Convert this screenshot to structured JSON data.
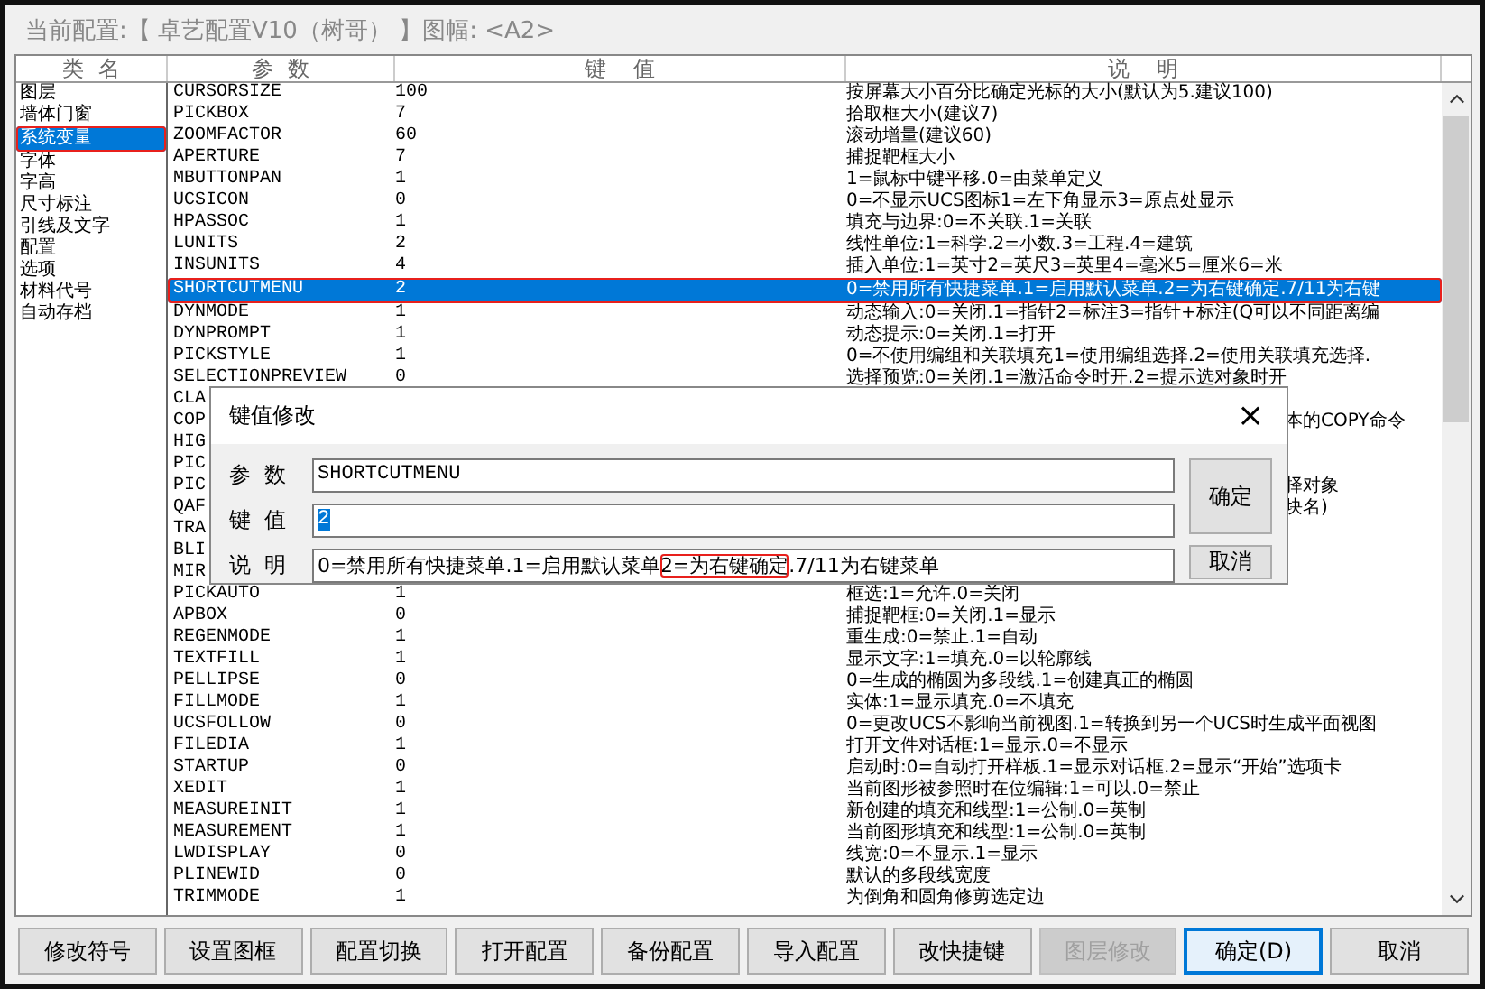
{
  "header": {
    "label": "当前配置:【 卓艺配置V10（树哥） 】图幅: <A2>"
  },
  "columns": [
    "类  名",
    "参  数",
    "键    值",
    "说    明"
  ],
  "categories": [
    {
      "label": "图层",
      "selected": false,
      "marked": false
    },
    {
      "label": "墙体门窗",
      "selected": false,
      "marked": false
    },
    {
      "label": "系统变量",
      "selected": true,
      "marked": true
    },
    {
      "label": "字体",
      "selected": false,
      "marked": false
    },
    {
      "label": "字高",
      "selected": false,
      "marked": false
    },
    {
      "label": "尺寸标注",
      "selected": false,
      "marked": false
    },
    {
      "label": "引线及文字",
      "selected": false,
      "marked": false
    },
    {
      "label": "配置",
      "selected": false,
      "marked": false
    },
    {
      "label": "选项",
      "selected": false,
      "marked": false
    },
    {
      "label": "材料代号",
      "selected": false,
      "marked": false
    },
    {
      "label": "自动存档",
      "selected": false,
      "marked": false
    }
  ],
  "rows": [
    {
      "param": "CURSORSIZE",
      "value": "100",
      "description": "按屏幕大小百分比确定光标的大小(默认为5.建议100)",
      "selected": false,
      "marked": false
    },
    {
      "param": "PICKBOX",
      "value": "7",
      "description": "拾取框大小(建议7)",
      "selected": false,
      "marked": false
    },
    {
      "param": "ZOOMFACTOR",
      "value": "60",
      "description": "滚动增量(建议60)",
      "selected": false,
      "marked": false
    },
    {
      "param": "APERTURE",
      "value": "7",
      "description": "捕捉靶框大小",
      "selected": false,
      "marked": false
    },
    {
      "param": "MBUTTONPAN",
      "value": "1",
      "description": "1=鼠标中键平移.0=由菜单定义",
      "selected": false,
      "marked": false
    },
    {
      "param": "UCSICON",
      "value": "0",
      "description": "0=不显示UCS图标1=左下角显示3=原点处显示",
      "selected": false,
      "marked": false
    },
    {
      "param": "HPASSOC",
      "value": "1",
      "description": "填充与边界:0=不关联.1=关联",
      "selected": false,
      "marked": false
    },
    {
      "param": "LUNITS",
      "value": "2",
      "description": "线性单位:1=科学.2=小数.3=工程.4=建筑",
      "selected": false,
      "marked": false
    },
    {
      "param": "INSUNITS",
      "value": "4",
      "description": "插入单位:1=英寸2=英尺3=英里4=毫米5=厘米6=米",
      "selected": false,
      "marked": false
    },
    {
      "param": "SHORTCUTMENU",
      "value": "2",
      "description": "0=禁用所有快捷菜单.1=启用默认菜单.2=为右键确定.7/11为右键",
      "selected": true,
      "marked": true
    },
    {
      "param": "DYNMODE",
      "value": "1",
      "description": "动态输入:0=关闭.1=指针2=标注3=指针+标注(Q可以不同距离编",
      "selected": false,
      "marked": false
    },
    {
      "param": "DYNPROMPT",
      "value": "1",
      "description": "动态提示:0=关闭.1=打开",
      "selected": false,
      "marked": false
    },
    {
      "param": "PICKSTYLE",
      "value": "1",
      "description": "0=不使用编组和关联填充1=使用编组选择.2=使用关联填充选择.",
      "selected": false,
      "marked": false
    },
    {
      "param": "SELECTIONPREVIEW",
      "value": "0",
      "description": "选择预览:0=关闭.1=激活命令时开.2=提示选对象时开",
      "selected": false,
      "marked": false
    },
    {
      "param": "CLA",
      "selected": false,
      "marked": false
    },
    {
      "param": "COP",
      "description": "本的COPY命令",
      "selected": false,
      "marked": false
    },
    {
      "param": "HIG",
      "selected": false,
      "marked": false
    },
    {
      "param": "PIC",
      "selected": false,
      "marked": false
    },
    {
      "param": "PIC",
      "description": "择对象",
      "selected": false,
      "marked": false
    },
    {
      "param": "QAF",
      "description": "块名)",
      "selected": false,
      "marked": false
    },
    {
      "param": "TRA",
      "selected": false,
      "marked": false
    },
    {
      "param": "BLI",
      "selected": false,
      "marked": false
    },
    {
      "param": "MIR",
      "selected": false,
      "marked": false
    },
    {
      "param": "PICKAUTO",
      "value": "1",
      "description": "框选:1=允许.0=关闭",
      "selected": false,
      "marked": false
    },
    {
      "param": "APBOX",
      "value": "0",
      "description": "捕捉靶框:0=关闭.1=显示",
      "selected": false,
      "marked": false
    },
    {
      "param": "REGENMODE",
      "value": "1",
      "description": "重生成:0=禁止.1=自动",
      "selected": false,
      "marked": false
    },
    {
      "param": "TEXTFILL",
      "value": "1",
      "description": "显示文字:1=填充.0=以轮廓线",
      "selected": false,
      "marked": false
    },
    {
      "param": "PELLIPSE",
      "value": "0",
      "description": "0=生成的椭圆为多段线.1=创建真正的椭圆",
      "selected": false,
      "marked": false
    },
    {
      "param": "FILLMODE",
      "value": "1",
      "description": "实体:1=显示填充.0=不填充",
      "selected": false,
      "marked": false
    },
    {
      "param": "UCSFOLLOW",
      "value": "0",
      "description": "0=更改UCS不影响当前视图.1=转换到另一个UCS时生成平面视图",
      "selected": false,
      "marked": false
    },
    {
      "param": "FILEDIA",
      "value": "1",
      "description": "打开文件对话框:1=显示.0=不显示",
      "selected": false,
      "marked": false
    },
    {
      "param": "STARTUP",
      "value": "0",
      "description": "启动时:0=自动打开样板.1=显示对话框.2=显示“开始”选项卡",
      "selected": false,
      "marked": false
    },
    {
      "param": "XEDIT",
      "value": "1",
      "description": "当前图形被参照时在位编辑:1=可以.0=禁止",
      "selected": false,
      "marked": false
    },
    {
      "param": "MEASUREINIT",
      "value": "1",
      "description": "新创建的填充和线型:1=公制.0=英制",
      "selected": false,
      "marked": false
    },
    {
      "param": "MEASUREMENT",
      "value": "1",
      "description": "当前图形填充和线型:1=公制.0=英制",
      "selected": false,
      "marked": false
    },
    {
      "param": "LWDISPLAY",
      "value": "0",
      "description": "线宽:0=不显示.1=显示",
      "selected": false,
      "marked": false
    },
    {
      "param": "PLINEWID",
      "value": "0",
      "description": "默认的多段线宽度",
      "selected": false,
      "marked": false
    },
    {
      "param": "TRIMMODE",
      "value": "1",
      "description": "为倒角和圆角修剪选定边",
      "selected": false,
      "marked": false
    }
  ],
  "dialog": {
    "title": "键值修改",
    "close": "×",
    "param_field": {
      "label": "参  数",
      "value": "SHORTCUTMENU"
    },
    "value_field": {
      "label": "键  值",
      "value": "2",
      "text_selected": true
    },
    "description_field": {
      "label": "说  明",
      "segments": [
        {
          "text": "0=禁用所有快捷菜单.1=启用默认菜单",
          "marked": false
        },
        {
          "text": "2=为右键确定",
          "marked": true
        },
        {
          "text": ".7/11为右键菜单",
          "marked": false
        }
      ]
    },
    "ok": "确定",
    "cancel": "取消"
  },
  "buttons": [
    {
      "label": "修改符号",
      "disabled": false,
      "default": false
    },
    {
      "label": "设置图框",
      "disabled": false,
      "default": false
    },
    {
      "label": "配置切换",
      "disabled": false,
      "default": false
    },
    {
      "label": "打开配置",
      "disabled": false,
      "default": false
    },
    {
      "label": "备份配置",
      "disabled": false,
      "default": false
    },
    {
      "label": "导入配置",
      "disabled": false,
      "default": false
    },
    {
      "label": "改快捷键",
      "disabled": false,
      "default": false
    },
    {
      "label": "图层修改",
      "disabled": true,
      "default": false
    },
    {
      "label": "确定(D)",
      "disabled": false,
      "default": true
    },
    {
      "label": "取消",
      "disabled": false,
      "default": false
    }
  ]
}
